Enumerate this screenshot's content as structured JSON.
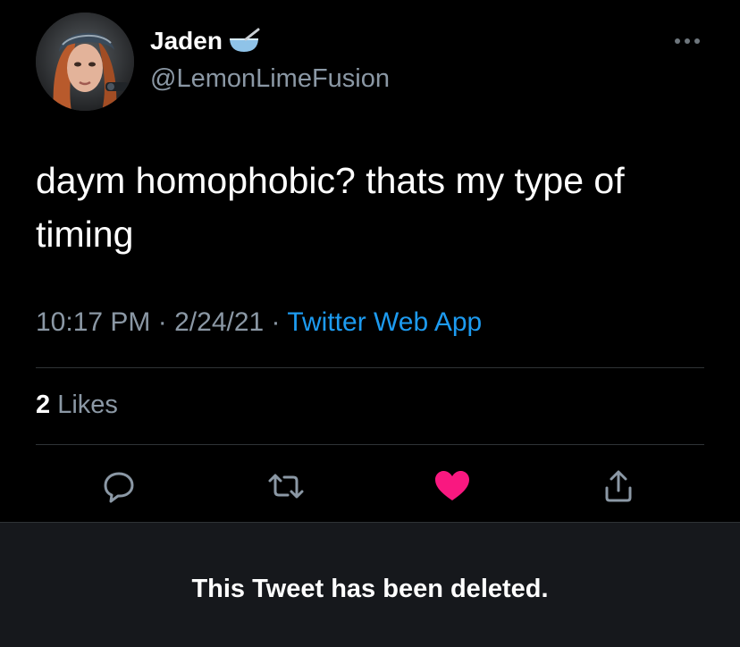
{
  "author": {
    "name": "Jaden",
    "name_emoji_icon": "bowl-spoon-icon",
    "handle": "@LemonLimeFusion"
  },
  "tweet": {
    "text": "daym homophobic? thats my type of timing",
    "time": "10:17 PM",
    "separator": "·",
    "date": "2/24/21",
    "source": "Twitter Web App"
  },
  "engagement": {
    "likes_count": "2",
    "likes_label": " Likes"
  },
  "actions": [
    "reply-icon",
    "retweet-icon",
    "like-icon",
    "share-icon"
  ],
  "notice": {
    "text": "This Tweet has been deleted."
  },
  "colors": {
    "background": "#000000",
    "secondary_text": "#8b98a5",
    "link": "#1d9bf0",
    "like_active": "#f91880",
    "banner": "#16181c"
  }
}
